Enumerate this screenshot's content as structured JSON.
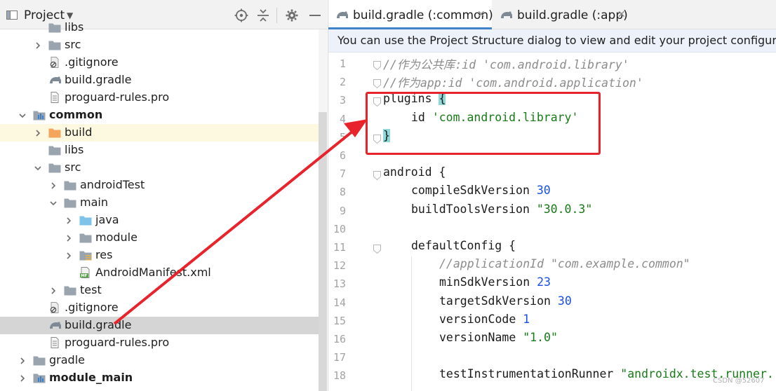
{
  "project_panel": {
    "title": "Project",
    "tree": [
      {
        "label": "libs",
        "icon": "folder-icon",
        "indent": 1,
        "chevron": "none"
      },
      {
        "label": "src",
        "icon": "folder-icon",
        "indent": 1,
        "chevron": "right"
      },
      {
        "label": ".gitignore",
        "icon": "gitignore-file-icon",
        "indent": 1,
        "chevron": "none"
      },
      {
        "label": "build.gradle",
        "icon": "gradle-file-icon",
        "indent": 1,
        "chevron": "none"
      },
      {
        "label": "proguard-rules.pro",
        "icon": "text-file-icon",
        "indent": 1,
        "chevron": "none"
      },
      {
        "label": "common",
        "icon": "module-folder-icon",
        "indent": 0,
        "chevron": "down",
        "bold": true
      },
      {
        "label": "build",
        "icon": "build-folder-icon",
        "indent": 1,
        "chevron": "right",
        "highlight": "yellow"
      },
      {
        "label": "libs",
        "icon": "folder-icon",
        "indent": 1,
        "chevron": "none"
      },
      {
        "label": "src",
        "icon": "folder-icon",
        "indent": 1,
        "chevron": "down"
      },
      {
        "label": "androidTest",
        "icon": "folder-icon",
        "indent": 2,
        "chevron": "right"
      },
      {
        "label": "main",
        "icon": "folder-icon",
        "indent": 2,
        "chevron": "down"
      },
      {
        "label": "java",
        "icon": "source-folder-icon",
        "indent": 3,
        "chevron": "right"
      },
      {
        "label": "module",
        "icon": "folder-icon",
        "indent": 3,
        "chevron": "right"
      },
      {
        "label": "res",
        "icon": "resource-folder-icon",
        "indent": 3,
        "chevron": "right"
      },
      {
        "label": "AndroidManifest.xml",
        "icon": "manifest-file-icon",
        "indent": 3,
        "chevron": "none"
      },
      {
        "label": "test",
        "icon": "folder-icon",
        "indent": 2,
        "chevron": "right"
      },
      {
        "label": ".gitignore",
        "icon": "gitignore-file-icon",
        "indent": 1,
        "chevron": "none"
      },
      {
        "label": "build.gradle",
        "icon": "gradle-file-icon",
        "indent": 1,
        "chevron": "none",
        "highlight": "selected"
      },
      {
        "label": "proguard-rules.pro",
        "icon": "text-file-icon",
        "indent": 1,
        "chevron": "none"
      },
      {
        "label": "gradle",
        "icon": "folder-icon",
        "indent": 0,
        "chevron": "right"
      },
      {
        "label": "module_main",
        "icon": "module-folder-icon",
        "indent": 0,
        "chevron": "right",
        "bold": true
      }
    ]
  },
  "editor": {
    "tabs": [
      {
        "label": "build.gradle (:common)",
        "active": true
      },
      {
        "label": "build.gradle (:app)",
        "active": false
      }
    ],
    "banner": "You can use the Project Structure dialog to view and edit your project configuration",
    "lines": [
      {
        "n": "1",
        "indent": 0,
        "fold": true,
        "tokens": [
          {
            "t": "//作为公共库:id 'com.android.library'",
            "c": "comment"
          }
        ]
      },
      {
        "n": "2",
        "indent": 0,
        "fold": true,
        "tokens": [
          {
            "t": "//作为app:id 'com.android.application'",
            "c": "comment"
          }
        ]
      },
      {
        "n": "3",
        "indent": 0,
        "fold": true,
        "tokens": [
          {
            "t": "plugins ",
            "c": "plain"
          },
          {
            "t": "{",
            "c": "brace"
          }
        ]
      },
      {
        "n": "4",
        "indent": 1,
        "fold": false,
        "tokens": [
          {
            "t": "id ",
            "c": "plain"
          },
          {
            "t": "'com.android.library'",
            "c": "string"
          }
        ]
      },
      {
        "n": "5",
        "indent": 0,
        "fold": true,
        "tokens": [
          {
            "t": "}",
            "c": "brace"
          }
        ]
      },
      {
        "n": "6",
        "indent": 0,
        "fold": false,
        "tokens": []
      },
      {
        "n": "7",
        "indent": 0,
        "fold": true,
        "tokens": [
          {
            "t": "android {",
            "c": "plain"
          }
        ]
      },
      {
        "n": "8",
        "indent": 1,
        "fold": false,
        "tokens": [
          {
            "t": "compileSdkVersion ",
            "c": "plain"
          },
          {
            "t": "30",
            "c": "number"
          }
        ]
      },
      {
        "n": "9",
        "indent": 1,
        "fold": false,
        "tokens": [
          {
            "t": "buildToolsVersion ",
            "c": "plain"
          },
          {
            "t": "\"30.0.3\"",
            "c": "string"
          }
        ]
      },
      {
        "n": "10",
        "indent": 0,
        "fold": false,
        "tokens": []
      },
      {
        "n": "11",
        "indent": 1,
        "fold": true,
        "tokens": [
          {
            "t": "defaultConfig {",
            "c": "plain"
          }
        ]
      },
      {
        "n": "12",
        "indent": 2,
        "fold": false,
        "tokens": [
          {
            "t": "//applicationId \"com.example.common\"",
            "c": "comment"
          }
        ]
      },
      {
        "n": "13",
        "indent": 2,
        "fold": false,
        "tokens": [
          {
            "t": "minSdkVersion ",
            "c": "plain"
          },
          {
            "t": "23",
            "c": "number"
          }
        ]
      },
      {
        "n": "14",
        "indent": 2,
        "fold": false,
        "tokens": [
          {
            "t": "targetSdkVersion ",
            "c": "plain"
          },
          {
            "t": "30",
            "c": "number"
          }
        ]
      },
      {
        "n": "15",
        "indent": 2,
        "fold": false,
        "tokens": [
          {
            "t": "versionCode ",
            "c": "plain"
          },
          {
            "t": "1",
            "c": "number"
          }
        ]
      },
      {
        "n": "16",
        "indent": 2,
        "fold": false,
        "tokens": [
          {
            "t": "versionName ",
            "c": "plain"
          },
          {
            "t": "\"1.0\"",
            "c": "string"
          }
        ]
      },
      {
        "n": "17",
        "indent": 0,
        "fold": false,
        "tokens": []
      },
      {
        "n": "18",
        "indent": 2,
        "fold": false,
        "tokens": [
          {
            "t": "testInstrumentationRunner ",
            "c": "plain"
          },
          {
            "t": "\"androidx.test.runner.",
            "c": "string"
          }
        ]
      }
    ]
  },
  "watermark": "CSDN @52607",
  "colors": {
    "accent": "#4083c9",
    "annotation": "#e8232b",
    "selected_row": "#d5d5d5"
  }
}
